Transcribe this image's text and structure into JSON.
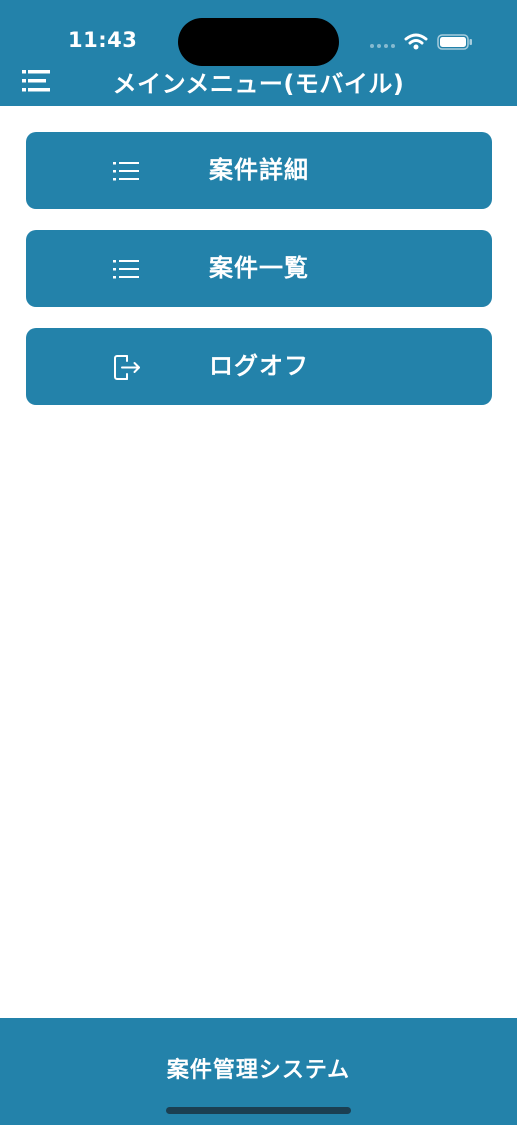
{
  "status_bar": {
    "time": "11:43"
  },
  "header": {
    "title": "メインメニュー(モバイル)",
    "menu_icon": "hamburger-menu-icon"
  },
  "menu": {
    "items": [
      {
        "label": "案件詳細",
        "icon": "list-icon"
      },
      {
        "label": "案件一覧",
        "icon": "list-icon"
      },
      {
        "label": "ログオフ",
        "icon": "logout-icon"
      }
    ]
  },
  "footer": {
    "title": "案件管理システム"
  },
  "colors": {
    "accent": "#2382aa",
    "background": "#ffffff",
    "text_on_accent": "#ffffff"
  }
}
